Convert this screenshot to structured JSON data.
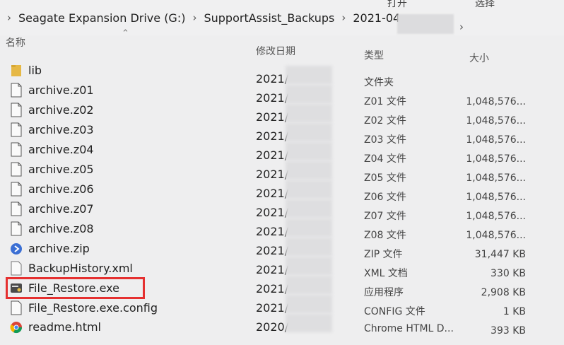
{
  "ribbon": {
    "left_label": "打开",
    "right_label": "选择"
  },
  "breadcrumb": [
    "Seagate Expansion Drive (G:)",
    "SupportAssist_Backups",
    "2021-04-"
  ],
  "columns": {
    "name": "名称",
    "date": "修改日期",
    "type": "类型",
    "size": "大小"
  },
  "files": [
    {
      "name": "lib",
      "date": "2021/",
      "type": "文件夹",
      "size": "",
      "icon": "folder-icon"
    },
    {
      "name": "archive.z01",
      "date": "2021/",
      "type": "Z01 文件",
      "size": "1,048,576...",
      "icon": "file-icon"
    },
    {
      "name": "archive.z02",
      "date": "2021/",
      "type": "Z02 文件",
      "size": "1,048,576...",
      "icon": "file-icon"
    },
    {
      "name": "archive.z03",
      "date": "2021/",
      "type": "Z03 文件",
      "size": "1,048,576...",
      "icon": "file-icon"
    },
    {
      "name": "archive.z04",
      "date": "2021/",
      "type": "Z04 文件",
      "size": "1,048,576...",
      "icon": "file-icon"
    },
    {
      "name": "archive.z05",
      "date": "2021/",
      "type": "Z05 文件",
      "size": "1,048,576...",
      "icon": "file-icon"
    },
    {
      "name": "archive.z06",
      "date": "2021/",
      "type": "Z06 文件",
      "size": "1,048,576...",
      "icon": "file-icon"
    },
    {
      "name": "archive.z07",
      "date": "2021/",
      "type": "Z07 文件",
      "size": "1,048,576...",
      "icon": "file-icon"
    },
    {
      "name": "archive.z08",
      "date": "2021/",
      "type": "Z08 文件",
      "size": "1,048,576...",
      "icon": "file-icon"
    },
    {
      "name": "archive.zip",
      "date": "2021/",
      "type": "ZIP 文件",
      "size": "31,447 KB",
      "icon": "zip-archive-icon"
    },
    {
      "name": "BackupHistory.xml",
      "date": "2021/",
      "type": "XML 文档",
      "size": "330 KB",
      "icon": "xml-file-icon"
    },
    {
      "name": "File_Restore.exe",
      "date": "2021/",
      "type": "应用程序",
      "size": "2,908 KB",
      "icon": "exe-app-icon"
    },
    {
      "name": "File_Restore.exe.config",
      "date": "2021/",
      "type": "CONFIG 文件",
      "size": "1 KB",
      "icon": "config-file-icon"
    },
    {
      "name": "readme.html",
      "date": "2020/",
      "type": "Chrome HTML D...",
      "size": "393 KB",
      "icon": "chrome-icon"
    }
  ],
  "highlight_color": "#e53030"
}
